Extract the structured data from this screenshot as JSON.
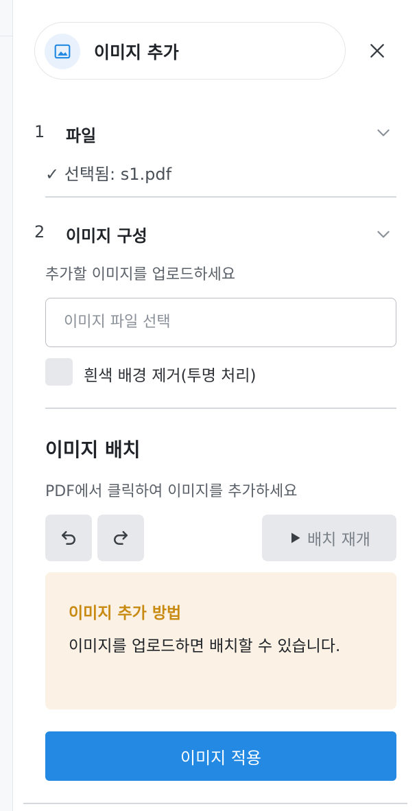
{
  "header": {
    "title": "이미지 추가",
    "icon": "image-icon"
  },
  "steps": [
    {
      "number": "1",
      "title": "파일",
      "status": "✓ 선택됨: s1.pdf"
    },
    {
      "number": "2",
      "title": "이미지 구성"
    }
  ],
  "config": {
    "hint": "추가할 이미지를 업로드하세요",
    "file_input_placeholder": "이미지 파일 선택",
    "remove_bg_label": "흰색 배경 제거(투명 처리)",
    "remove_bg_checked": false
  },
  "placement": {
    "title": "이미지 배치",
    "hint": "PDF에서 클릭하여 이미지를 추가하세요",
    "resume_label": "배치 재개"
  },
  "info": {
    "title": "이미지 추가 방법",
    "body": "이미지를 업로드하면 배치할 수 있습니다."
  },
  "apply_label": "이미지 적용",
  "colors": {
    "accent": "#2389e3",
    "info_bg": "#fbf1e4",
    "info_title": "#c98a12"
  }
}
